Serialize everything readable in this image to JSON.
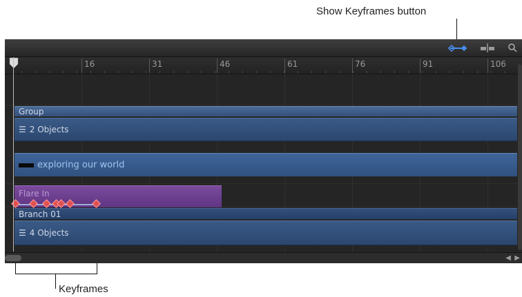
{
  "callouts": {
    "show_keyframes": "Show Keyframes button",
    "keyframes": "Keyframes"
  },
  "toolbar": {
    "icons": [
      "show-keyframes-icon",
      "snapping-icon",
      "zoom-icon"
    ]
  },
  "ruler": {
    "ticks": [
      "16",
      "31",
      "46",
      "61",
      "76",
      "91",
      "106"
    ]
  },
  "tracks": {
    "group": "Group",
    "group_objects": "2 Objects",
    "text_layer": "exploring our world",
    "behavior": "Flare In",
    "branch": "Branch 01",
    "branch_objects": "4 Objects"
  },
  "colors": {
    "group_bar": "#3f5f8f",
    "behavior_bar": "#6b3f8f",
    "keyframe": "#e05050",
    "keyframe_button": "#4a8df0"
  }
}
